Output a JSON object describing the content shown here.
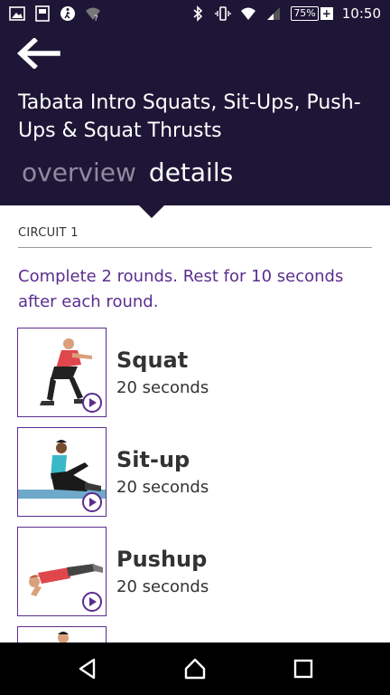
{
  "status_bar": {
    "battery": "75%",
    "time": "10:50",
    "left_icons": [
      "gallery-icon",
      "save-icon",
      "walk-icon",
      "wifi-question-icon"
    ],
    "right_icons": [
      "bluetooth-icon",
      "vibrate-icon",
      "wifi-icon",
      "signal-icon",
      "battery-icon"
    ]
  },
  "header": {
    "title": "Tabata Intro Squats, Sit-Ups, Push-Ups & Squat Thrusts",
    "tabs": [
      {
        "label": "overview",
        "active": false
      },
      {
        "label": "details",
        "active": true
      }
    ]
  },
  "circuit": {
    "label": "CIRCUIT 1",
    "description": "Complete 2 rounds. Rest for 10 seconds after each round."
  },
  "exercises": [
    {
      "name": "Squat",
      "duration": "20 seconds"
    },
    {
      "name": "Sit-up",
      "duration": "20 seconds"
    },
    {
      "name": "Pushup",
      "duration": "20 seconds"
    }
  ],
  "colors": {
    "header_bg": "#1e1636",
    "accent": "#5b2d8e",
    "inactive_tab": "#8f8aa0"
  }
}
